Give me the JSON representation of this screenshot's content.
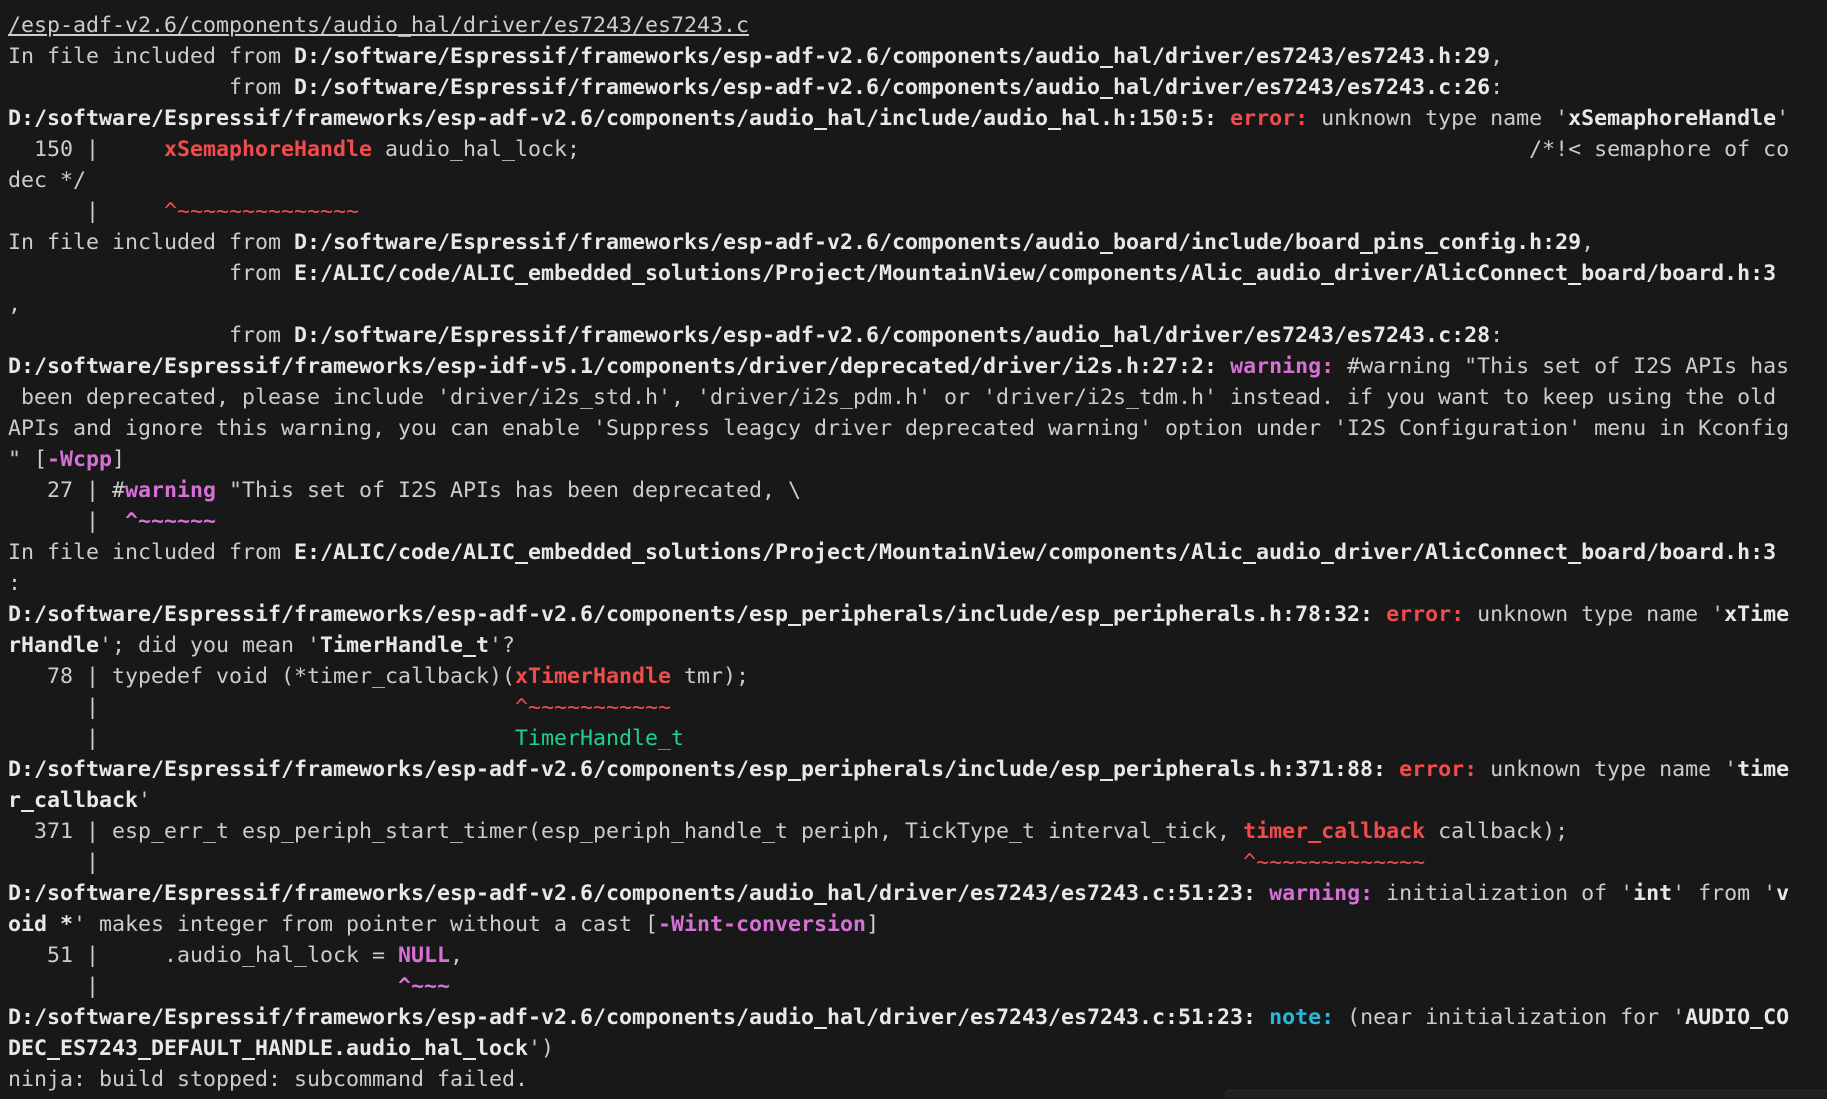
{
  "colors": {
    "background": "#181818",
    "text": "#cccccc",
    "error": "#f14c4c",
    "warning": "#d670d6",
    "note": "#29b8db",
    "fixit": "#23d18b"
  },
  "lines": [
    [
      [
        "/esp-adf-v2.6/components/audio_hal/driver/es7243/es7243.c",
        "u"
      ]
    ],
    [
      [
        "In file included from ",
        ""
      ],
      [
        "D:/software/Espressif/frameworks/esp-adf-v2.6/components/audio_hal/driver/es7243/es7243.h:29",
        "b"
      ],
      [
        ",",
        ""
      ]
    ],
    [
      [
        "                 from ",
        ""
      ],
      [
        "D:/software/Espressif/frameworks/esp-adf-v2.6/components/audio_hal/driver/es7243/es7243.c:26",
        "b"
      ],
      [
        ":",
        ""
      ]
    ],
    [
      [
        "D:/software/Espressif/frameworks/esp-adf-v2.6/components/audio_hal/include/audio_hal.h:150:5:",
        "b"
      ],
      [
        " ",
        ""
      ],
      [
        "error:",
        "r"
      ],
      [
        " unknown type name '",
        ""
      ],
      [
        "xSemaphoreHandle",
        "b"
      ],
      [
        "'",
        ""
      ]
    ],
    [
      [
        "  150 |     ",
        ""
      ],
      [
        "xSemaphoreHandle",
        "r"
      ],
      [
        " audio_hal_lock;                                                                         /*!< semaphore of co",
        ""
      ]
    ],
    [
      [
        "dec */",
        ""
      ]
    ],
    [
      [
        "      |     ",
        ""
      ],
      [
        "^~~~~~~~~~~~~~~",
        "rn"
      ]
    ],
    [
      [
        "In file included from ",
        ""
      ],
      [
        "D:/software/Espressif/frameworks/esp-adf-v2.6/components/audio_board/include/board_pins_config.h:29",
        "b"
      ],
      [
        ",",
        ""
      ]
    ],
    [
      [
        "                 from ",
        ""
      ],
      [
        "E:/ALIC/code/ALIC_embedded_solutions/Project/MountainView/components/Alic_audio_driver/AlicConnect_board/board.h:3",
        "b"
      ]
    ],
    [
      [
        ",",
        ""
      ]
    ],
    [
      [
        "                 from ",
        ""
      ],
      [
        "D:/software/Espressif/frameworks/esp-adf-v2.6/components/audio_hal/driver/es7243/es7243.c:28",
        "b"
      ],
      [
        ":",
        ""
      ]
    ],
    [
      [
        "D:/software/Espressif/frameworks/esp-idf-v5.1/components/driver/deprecated/driver/i2s.h:27:2:",
        "b"
      ],
      [
        " ",
        ""
      ],
      [
        "warning:",
        "m"
      ],
      [
        " #warning \"This set of I2S APIs has",
        ""
      ]
    ],
    [
      [
        " been deprecated, please include 'driver/i2s_std.h', 'driver/i2s_pdm.h' or 'driver/i2s_tdm.h' instead. if you want to keep using the old",
        ""
      ]
    ],
    [
      [
        "APIs and ignore this warning, you can enable 'Suppress leagcy driver deprecated warning' option under 'I2S Configuration' menu in Kconfig",
        ""
      ]
    ],
    [
      [
        "\" [",
        ""
      ],
      [
        "-Wcpp",
        "m"
      ],
      [
        "]",
        ""
      ]
    ],
    [
      [
        "   27 | #",
        ""
      ],
      [
        "warning",
        "m"
      ],
      [
        " \"This set of I2S APIs has been deprecated, \\",
        ""
      ]
    ],
    [
      [
        "      |  ",
        ""
      ],
      [
        "^~~~~~~",
        "m"
      ]
    ],
    [
      [
        "In file included from ",
        ""
      ],
      [
        "E:/ALIC/code/ALIC_embedded_solutions/Project/MountainView/components/Alic_audio_driver/AlicConnect_board/board.h:3",
        "b"
      ]
    ],
    [
      [
        ":",
        ""
      ]
    ],
    [
      [
        "D:/software/Espressif/frameworks/esp-adf-v2.6/components/esp_peripherals/include/esp_peripherals.h:78:32:",
        "b"
      ],
      [
        " ",
        ""
      ],
      [
        "error:",
        "r"
      ],
      [
        " unknown type name '",
        ""
      ],
      [
        "xTime",
        "b"
      ]
    ],
    [
      [
        "rHandle",
        "b"
      ],
      [
        "'; did you mean '",
        ""
      ],
      [
        "TimerHandle_t",
        "b"
      ],
      [
        "'?",
        ""
      ]
    ],
    [
      [
        "   78 | typedef void (*timer_callback)(",
        ""
      ],
      [
        "xTimerHandle",
        "r"
      ],
      [
        " tmr);",
        ""
      ]
    ],
    [
      [
        "      |                                ",
        ""
      ],
      [
        "^~~~~~~~~~~~",
        "rn"
      ]
    ],
    [
      [
        "      |                                ",
        ""
      ],
      [
        "TimerHandle_t",
        "g"
      ]
    ],
    [
      [
        "D:/software/Espressif/frameworks/esp-adf-v2.6/components/esp_peripherals/include/esp_peripherals.h:371:88:",
        "b"
      ],
      [
        " ",
        ""
      ],
      [
        "error:",
        "r"
      ],
      [
        " unknown type name '",
        ""
      ],
      [
        "time",
        "b"
      ]
    ],
    [
      [
        "r_callback",
        "b"
      ],
      [
        "'",
        ""
      ]
    ],
    [
      [
        "  371 | esp_err_t esp_periph_start_timer(esp_periph_handle_t periph, TickType_t interval_tick, ",
        ""
      ],
      [
        "timer_callback",
        "r"
      ],
      [
        " callback);",
        ""
      ]
    ],
    [
      [
        "      |                                                                                        ",
        ""
      ],
      [
        "^~~~~~~~~~~~~~",
        "rn"
      ]
    ],
    [
      [
        "D:/software/Espressif/frameworks/esp-adf-v2.6/components/audio_hal/driver/es7243/es7243.c:51:23:",
        "b"
      ],
      [
        " ",
        ""
      ],
      [
        "warning:",
        "m"
      ],
      [
        " initialization of '",
        ""
      ],
      [
        "int",
        "b"
      ],
      [
        "' from '",
        ""
      ],
      [
        "v",
        "b"
      ]
    ],
    [
      [
        "oid *",
        "b"
      ],
      [
        "' makes integer from pointer without a cast [",
        ""
      ],
      [
        "-Wint-conversion",
        "m"
      ],
      [
        "]",
        ""
      ]
    ],
    [
      [
        "   51 |     .audio_hal_lock = ",
        ""
      ],
      [
        "NULL",
        "m"
      ],
      [
        ",",
        ""
      ]
    ],
    [
      [
        "      |                       ",
        ""
      ],
      [
        "^~~~",
        "m"
      ]
    ],
    [
      [
        "D:/software/Espressif/frameworks/esp-adf-v2.6/components/audio_hal/driver/es7243/es7243.c:51:23:",
        "b"
      ],
      [
        " ",
        ""
      ],
      [
        "note:",
        "c"
      ],
      [
        " (near initialization for '",
        ""
      ],
      [
        "AUDIO_CO",
        "b"
      ]
    ],
    [
      [
        "DEC_ES7243_DEFAULT_HANDLE.audio_hal_lock",
        "b"
      ],
      [
        "')",
        ""
      ]
    ],
    [
      [
        "ninja: build stopped: subcommand failed.",
        ""
      ]
    ]
  ]
}
